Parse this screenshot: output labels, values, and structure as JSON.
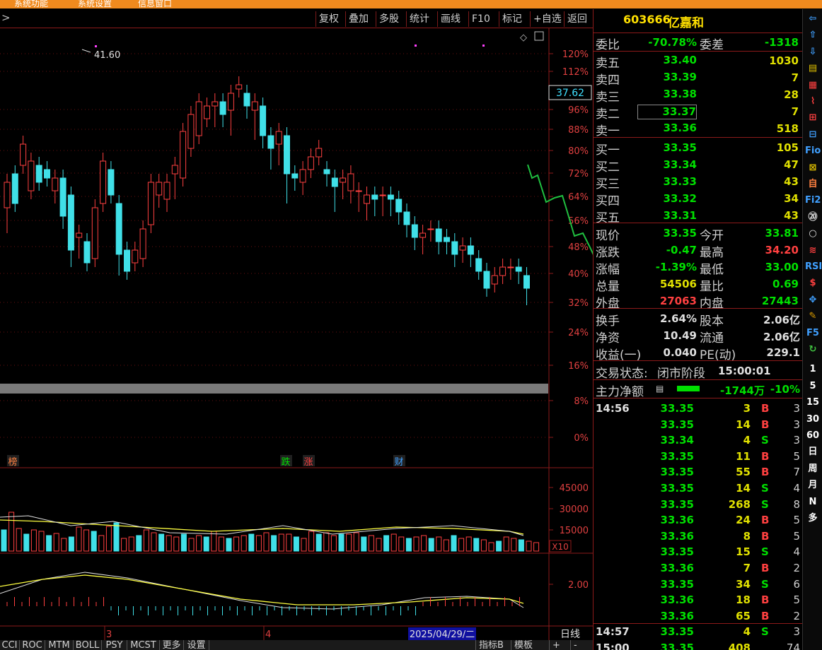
{
  "window": {
    "title_fragments": [
      "系统功能",
      "系统设置",
      "信息窗口"
    ]
  },
  "toolbar": {
    "collapse_glyph": ">",
    "buttons": [
      "复权",
      "叠加",
      "多股",
      "统计",
      "画线",
      "F10",
      "标记",
      "+自选",
      "返回"
    ]
  },
  "stock": {
    "code": "603666",
    "name": "亿嘉和"
  },
  "weibi": {
    "label": "委比",
    "value": "-70.78%",
    "diff_label": "委差",
    "diff_value": "-1318"
  },
  "sells": [
    {
      "label": "卖五",
      "price": "33.40",
      "vol": "1030"
    },
    {
      "label": "卖四",
      "price": "33.39",
      "vol": "7"
    },
    {
      "label": "卖三",
      "price": "33.38",
      "vol": "28"
    },
    {
      "label": "卖二",
      "price": "33.37",
      "vol": "7"
    },
    {
      "label": "卖一",
      "price": "33.36",
      "vol": "518"
    }
  ],
  "buys": [
    {
      "label": "买一",
      "price": "33.35",
      "vol": "105"
    },
    {
      "label": "买二",
      "price": "33.34",
      "vol": "47"
    },
    {
      "label": "买三",
      "price": "33.33",
      "vol": "43"
    },
    {
      "label": "买四",
      "price": "33.32",
      "vol": "34"
    },
    {
      "label": "买五",
      "price": "33.31",
      "vol": "43"
    }
  ],
  "quote": [
    {
      "l1": "现价",
      "v1": "33.35",
      "c1": "#00e000",
      "l2": "今开",
      "v2": "33.81",
      "c2": "#00e000"
    },
    {
      "l1": "涨跌",
      "v1": "-0.47",
      "c1": "#00e000",
      "l2": "最高",
      "v2": "34.20",
      "c2": "#ff4040"
    },
    {
      "l1": "涨幅",
      "v1": "-1.39%",
      "c1": "#00e000",
      "l2": "最低",
      "v2": "33.00",
      "c2": "#00e000"
    },
    {
      "l1": "总量",
      "v1": "54506",
      "c1": "#e0e000",
      "l2": "量比",
      "v2": "0.69",
      "c2": "#00e000"
    },
    {
      "l1": "外盘",
      "v1": "27063",
      "c1": "#ff4040",
      "l2": "内盘",
      "v2": "27443",
      "c2": "#00e000"
    }
  ],
  "fund": [
    {
      "l1": "换手",
      "v1": "2.64%",
      "l2": "股本",
      "v2": "2.06亿"
    },
    {
      "l1": "净资",
      "v1": "10.49",
      "l2": "流通",
      "v2": "2.06亿"
    },
    {
      "l1": "收益(一)",
      "v1": "0.040",
      "l2": "PE(动)",
      "v2": "229.1"
    }
  ],
  "status": {
    "label": "交易状态:",
    "value": "闭市阶段",
    "time": "15:00:01"
  },
  "main_force": {
    "label": "主力净额",
    "value": "-1744万",
    "pct": "-10%"
  },
  "ticks": [
    {
      "time": "14:56",
      "price": "33.35",
      "vol": "3",
      "bs": "B",
      "n": "3"
    },
    {
      "time": "",
      "price": "33.35",
      "vol": "14",
      "bs": "B",
      "n": "3"
    },
    {
      "time": "",
      "price": "33.34",
      "vol": "4",
      "bs": "S",
      "n": "3"
    },
    {
      "time": "",
      "price": "33.35",
      "vol": "11",
      "bs": "B",
      "n": "5"
    },
    {
      "time": "",
      "price": "33.35",
      "vol": "55",
      "bs": "B",
      "n": "7"
    },
    {
      "time": "",
      "price": "33.35",
      "vol": "14",
      "bs": "S",
      "n": "4"
    },
    {
      "time": "",
      "price": "33.35",
      "vol": "268",
      "bs": "S",
      "n": "8"
    },
    {
      "time": "",
      "price": "33.36",
      "vol": "24",
      "bs": "B",
      "n": "5"
    },
    {
      "time": "",
      "price": "33.36",
      "vol": "8",
      "bs": "B",
      "n": "5"
    },
    {
      "time": "",
      "price": "33.35",
      "vol": "15",
      "bs": "S",
      "n": "4"
    },
    {
      "time": "",
      "price": "33.36",
      "vol": "7",
      "bs": "B",
      "n": "2"
    },
    {
      "time": "",
      "price": "33.35",
      "vol": "34",
      "bs": "S",
      "n": "6"
    },
    {
      "time": "",
      "price": "33.36",
      "vol": "18",
      "bs": "B",
      "n": "5"
    },
    {
      "time": "",
      "price": "33.36",
      "vol": "65",
      "bs": "B",
      "n": "2"
    },
    {
      "time": "14:57",
      "price": "33.35",
      "vol": "4",
      "bs": "S",
      "n": "3"
    },
    {
      "time": "15:00",
      "price": "33.35",
      "vol": "408",
      "bs": "",
      "n": "74"
    }
  ],
  "chart": {
    "high_marker": "41.60",
    "price_tag": "37.62",
    "pct_axis": [
      "120%",
      "112%",
      "96%",
      "88%",
      "80%",
      "72%",
      "64%",
      "56%",
      "48%",
      "40%",
      "32%",
      "24%",
      "16%",
      "8%",
      "0%"
    ],
    "vol_axis": [
      "45000",
      "30000",
      "15000"
    ],
    "vol_unit": "X10",
    "ind_axis": "2.00",
    "event_tags": [
      "榜",
      "跌",
      "涨",
      "财"
    ],
    "x_labels": [
      "3",
      "4"
    ],
    "date_label": "2025/04/29/二",
    "period": "日线"
  },
  "bottom_tabs": [
    "CCI",
    "ROC",
    "MTM",
    "BOLL",
    "PSY",
    "MCST",
    "更多",
    "设置"
  ],
  "bottom_right": [
    "指标B",
    "模板",
    "+",
    "-"
  ],
  "side_tools": [
    "⇦",
    "⇧",
    "⇩",
    "▤",
    "▦",
    "⌇",
    "⊞",
    "⊟",
    "Fio",
    "⊠",
    "自",
    "Fi2",
    "⑳",
    "○",
    "≋",
    "RSI",
    "$",
    "✥",
    "✎",
    "F5",
    "↻",
    "1",
    "5",
    "15",
    "30",
    "60",
    "日",
    "周",
    "月",
    "N",
    "多"
  ],
  "candles": [
    [
      21,
      27,
      0,
      17,
      1
    ],
    [
      29,
      22,
      0,
      27,
      0
    ],
    [
      31,
      36,
      0,
      40,
      0
    ],
    [
      25,
      32,
      0,
      33,
      0
    ],
    [
      31,
      27,
      0,
      34,
      0
    ],
    [
      30,
      28,
      0,
      30,
      0
    ],
    [
      25,
      28,
      0,
      24,
      0
    ],
    [
      28,
      19,
      0,
      18,
      0
    ],
    [
      24,
      11,
      0,
      9,
      0
    ],
    [
      14,
      15,
      0,
      11,
      0
    ],
    [
      13,
      8,
      0,
      8,
      0
    ],
    [
      9,
      21,
      0,
      21,
      0
    ],
    [
      22,
      32,
      0,
      31,
      0
    ],
    [
      30,
      24,
      0,
      26,
      0
    ],
    [
      22,
      10,
      0,
      7,
      0
    ],
    [
      11,
      6,
      0,
      6,
      0
    ],
    [
      8,
      11,
      0,
      10,
      0
    ],
    [
      9,
      16,
      0,
      15,
      0
    ],
    [
      17,
      27,
      0,
      25,
      0
    ],
    [
      24,
      27,
      0,
      23,
      0
    ],
    [
      23,
      27,
      0,
      22,
      0
    ],
    [
      29,
      31,
      0,
      25,
      0
    ],
    [
      28,
      39,
      0,
      38,
      0
    ],
    [
      35,
      43,
      0,
      43,
      0
    ],
    [
      38,
      46,
      0,
      45,
      0
    ],
    [
      42,
      45,
      0,
      44,
      0
    ],
    [
      45,
      46,
      0,
      42,
      0
    ],
    [
      46,
      43,
      0,
      42,
      0
    ],
    [
      44,
      48,
      0,
      40,
      0
    ],
    [
      49,
      50,
      0,
      49,
      0
    ],
    [
      48,
      45,
      0,
      44,
      0
    ],
    [
      44,
      46,
      0,
      39,
      0
    ],
    [
      45,
      38,
      0,
      37,
      0
    ],
    [
      38,
      35,
      0,
      32,
      0
    ],
    [
      36,
      39,
      0,
      33,
      0
    ],
    [
      38,
      29,
      0,
      24,
      0
    ],
    [
      29,
      28,
      0,
      27,
      0
    ],
    [
      27,
      30,
      0,
      26,
      0
    ],
    [
      30,
      33,
      0,
      32,
      0
    ],
    [
      33,
      35,
      0,
      35,
      0
    ],
    [
      30,
      29,
      0,
      28,
      0
    ],
    [
      28,
      26,
      0,
      22,
      0
    ],
    [
      27,
      28,
      0,
      25,
      0
    ],
    [
      25,
      29,
      0,
      24,
      0
    ],
    [
      25,
      25,
      0,
      22,
      0
    ],
    [
      22,
      24,
      0,
      20,
      0
    ],
    [
      24,
      23,
      0,
      21,
      0
    ],
    [
      24,
      24,
      0,
      21,
      0
    ],
    [
      24,
      23,
      0,
      21,
      0
    ],
    [
      23,
      20,
      0,
      19,
      0
    ],
    [
      20,
      17,
      0,
      16,
      0
    ],
    [
      17,
      14,
      0,
      13,
      0
    ],
    [
      14,
      15,
      0,
      12,
      0
    ],
    [
      16,
      16,
      0,
      15,
      0
    ],
    [
      16,
      13,
      0,
      12,
      0
    ],
    [
      14,
      13,
      0,
      12,
      0
    ],
    [
      13,
      10,
      0,
      9,
      0
    ],
    [
      11,
      12,
      0,
      10,
      0
    ],
    [
      12,
      10,
      0,
      9,
      0
    ],
    [
      9,
      6,
      0,
      6,
      0
    ],
    [
      6,
      2,
      0,
      2,
      0
    ],
    [
      3,
      5,
      0,
      3,
      0
    ],
    [
      5,
      7,
      0,
      5,
      0
    ],
    [
      7,
      7,
      0,
      6,
      0
    ],
    [
      7,
      6,
      0,
      5,
      0
    ],
    [
      5,
      2,
      0,
      0,
      0
    ]
  ]
}
